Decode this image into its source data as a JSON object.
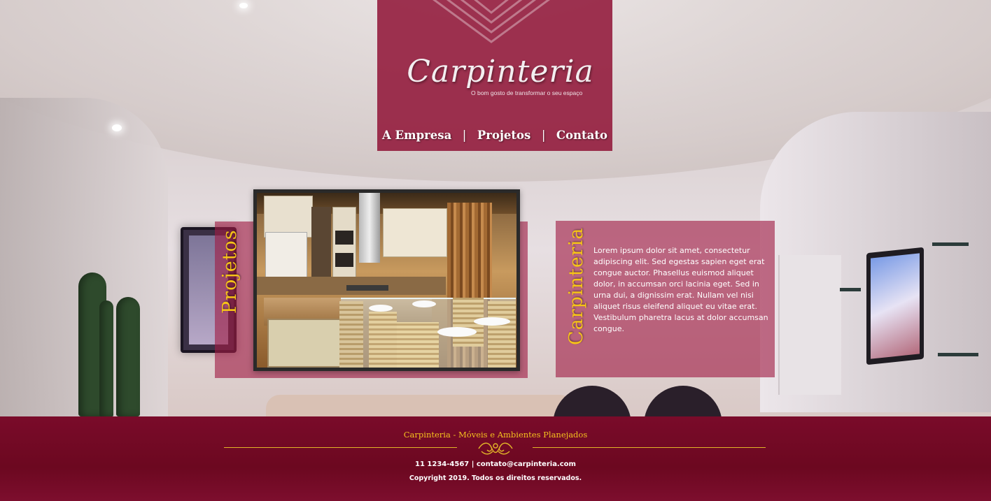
{
  "header": {
    "logo_text": "Carpinteria",
    "tagline": "O bom gosto de transformar o seu espaço"
  },
  "nav": {
    "items": [
      {
        "label": "A Empresa"
      },
      {
        "label": "Projetos"
      },
      {
        "label": "Contato"
      }
    ],
    "separator": "|"
  },
  "sections": {
    "projetos_title": "Projetos",
    "carpinteria_title": "Carpinteria",
    "carpinteria_text": "Lorem ipsum dolor sit amet, consectetur adipiscing elit. Sed egestas sapien eget erat congue auctor. Phasellus euismod aliquet dolor, in accumsan orci lacinia eget. Sed in urna dui, a dignissim erat. Nullam vel nisi aliquet risus eleifend aliquet eu vitae erat. Vestibulum pharetra lacus at dolor accumsan congue."
  },
  "footer": {
    "brand": "Carpinteria - Móveis e Ambientes Planejados",
    "contact": "11 1234-4567 | contato@carpinteria.com",
    "copyright": "Copyright 2019. Todos os direitos reservados."
  },
  "colors": {
    "brand": "#92183a",
    "accent": "#f6c318",
    "footer": "#6c0820"
  }
}
